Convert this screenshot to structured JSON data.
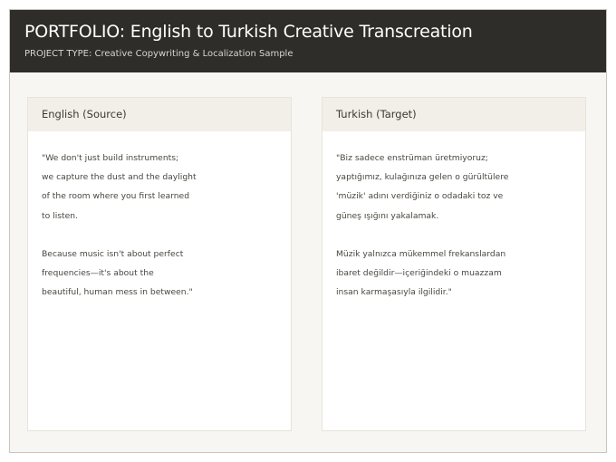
{
  "header": {
    "title": "PORTFOLIO: English to Turkish Creative Transcreation",
    "subtitle": "PROJECT TYPE: Creative Copywriting & Localization Sample"
  },
  "source": {
    "label": "English (Source)",
    "paragraph1": [
      "\"We don't just build instruments;",
      "we capture the dust and the daylight",
      "of the room where you first learned",
      "to listen."
    ],
    "paragraph2": [
      "Because music isn't about perfect",
      "frequencies—it's about the",
      "beautiful, human mess in between.\""
    ]
  },
  "target": {
    "label": "Turkish (Target)",
    "paragraph1": [
      "\"Biz sadece enstrüman üretmiyoruz;",
      "yaptığımız, kulağınıza gelen o gürültülere",
      "'müzik' adını verdiğiniz o odadaki toz ve",
      "güneş ışığını yakalamak."
    ],
    "paragraph2": [
      "Müzik yalnızca mükemmel frekanslardan",
      "ibaret değildir—içeriğindeki o muazzam",
      "insan karmaşasıyla ilgilidir.\""
    ]
  }
}
